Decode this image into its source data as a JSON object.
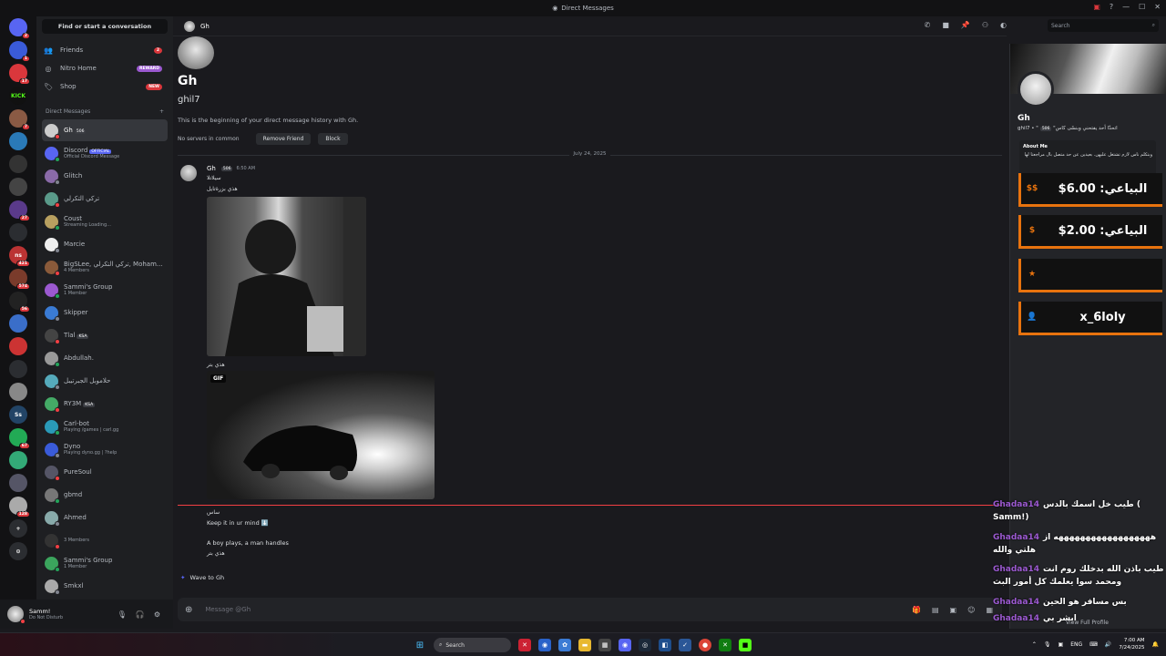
{
  "window": {
    "title": "Direct Messages"
  },
  "sidebar": {
    "find_placeholder": "Find or start a conversation",
    "nav": [
      {
        "label": "Friends",
        "badge": "2"
      },
      {
        "label": "Nitro Home",
        "badge": "REWARD"
      },
      {
        "label": "Shop",
        "badge": "NEW"
      }
    ],
    "dm_header": "Direct Messages",
    "dms": [
      {
        "name": "Gh",
        "tag": "506",
        "sub": ""
      },
      {
        "name": "Discord",
        "tag": "OFFICIAL",
        "sub": "Official Discord Message"
      },
      {
        "name": "Glitch",
        "tag": "",
        "sub": ""
      },
      {
        "name": "تركي التكرلي",
        "tag": "",
        "sub": ""
      },
      {
        "name": "Coust",
        "tag": "",
        "sub": "Streaming Loading..."
      },
      {
        "name": "Marcie",
        "tag": "",
        "sub": ""
      },
      {
        "name": "BigSLee, تركي التكرلي, Moham...",
        "tag": "",
        "sub": "4 Members"
      },
      {
        "name": "Sammi's Group",
        "tag": "",
        "sub": "1 Member"
      },
      {
        "name": "Skipper",
        "tag": "",
        "sub": ""
      },
      {
        "name": "Tlal",
        "tag": "KSA",
        "sub": ""
      },
      {
        "name": "Abdullah.",
        "tag": "",
        "sub": ""
      },
      {
        "name": "حلاموبل الجبرتيبل",
        "tag": "",
        "sub": ""
      },
      {
        "name": "RY3M",
        "tag": "KSA",
        "sub": ""
      },
      {
        "name": "Carl-bot",
        "tag": "",
        "sub": "Playing /games | carl.gg"
      },
      {
        "name": "Dyno",
        "tag": "",
        "sub": "Playing dyno.gg | ?help"
      },
      {
        "name": "PureSoul",
        "tag": "",
        "sub": ""
      },
      {
        "name": "gbmd",
        "tag": "",
        "sub": ""
      },
      {
        "name": "Ahmed",
        "tag": "",
        "sub": ""
      },
      {
        "name": "",
        "tag": "",
        "sub": "3 Members"
      },
      {
        "name": "Sammi's Group",
        "tag": "",
        "sub": "1 Member"
      },
      {
        "name": "Smkxl",
        "tag": "",
        "sub": ""
      }
    ],
    "server_badges": [
      "2",
      "1",
      "17",
      "",
      "7",
      "",
      "",
      "",
      "27",
      "",
      "421",
      "574",
      "56",
      "",
      "",
      "",
      "",
      "",
      "67",
      "",
      "",
      "128"
    ],
    "user": {
      "name": "Samm!",
      "status": "Do Not Disturb"
    }
  },
  "chat": {
    "header_name": "Gh",
    "search_placeholder": "Search",
    "intro": {
      "name": "Gh",
      "username": "ghil7",
      "text": "This is the beginning of your direct message history with Gh.",
      "mutual": "No servers in common",
      "remove_friend": "Remove Friend",
      "block": "Block"
    },
    "date": "July 24, 2025",
    "message": {
      "author": "Gh",
      "tag": "506",
      "time": "6:50 AM",
      "line1": "سيلاتلا",
      "line2": "هذي بزرةتايل",
      "caption1": "هذي بتر",
      "gif_label": "GIF",
      "line3": "ساس",
      "line4": "Keep it in ur mind ⬇️",
      "line5": "A boy plays, a man handles",
      "line6": "هذي بتر"
    },
    "wave": "Wave to Gh",
    "composer_placeholder": "Message @Gh"
  },
  "profile": {
    "name": "Gh",
    "username": "ghil7 • \"اتحدّا أحد يفتحني وبنسّى كاس\"",
    "tag": "506",
    "about_title": "About Me",
    "about_text": "وبتكلم ناس لازم تشتغل عليهن. بعيدين عن حد متصل بال مراجعتا لها",
    "view_full": "View Full Profile"
  },
  "overlay": {
    "items": [
      {
        "icon": "$$",
        "text": "البياعي: 6.00$"
      },
      {
        "icon": "$",
        "text": "البياعي: 2.00$"
      },
      {
        "icon": "★",
        "text": ""
      },
      {
        "icon": "👤",
        "text": "x_6loly"
      }
    ],
    "chat": [
      {
        "user": "Ghadaa14",
        "text": "طيب خل اسمك بالدس ( Samm!)"
      },
      {
        "user": "Ghadaa14",
        "text": "ههههههههههههههههههه از هلتي والله"
      },
      {
        "user": "Ghadaa14",
        "text": "طيب باذن الله بدخلك روم انت ومحمد سوا يعلمك كل أمور البث"
      },
      {
        "user": "Ghadaa14",
        "text": "بس مسافر هو الحين"
      },
      {
        "user": "Ghadaa14",
        "text": "ابشر بي"
      }
    ]
  },
  "taskbar": {
    "search": "Search",
    "lang": "ENG",
    "time": "7:00 AM",
    "date": "7/24/2025"
  }
}
